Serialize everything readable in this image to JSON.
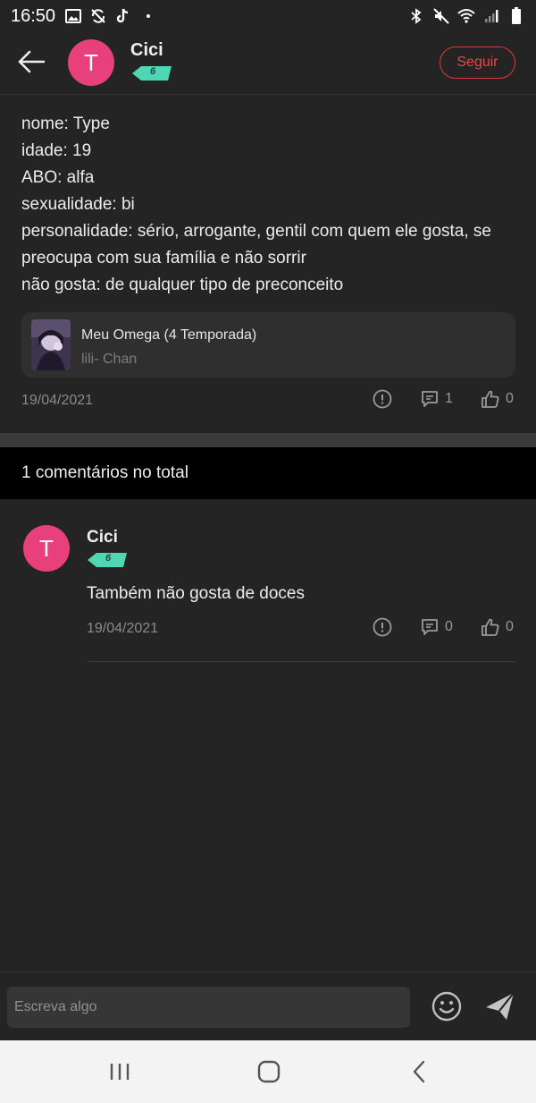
{
  "status_bar": {
    "time": "16:50"
  },
  "header": {
    "user_name": "Cici",
    "avatar_initial": "T",
    "level": "6",
    "follow_label": "Seguir"
  },
  "post": {
    "lines": [
      "nome: Type",
      "idade: 19",
      "ABO: alfa",
      "sexualidade: bi",
      "personalidade: sério, arrogante, gentil com quem ele gosta, se preocupa com sua família e não sorrir",
      "não gosta: de qualquer tipo de preconceito"
    ],
    "linked_story": {
      "title": "Meu Omega (4 Temporada)",
      "author": "lili- Chan"
    },
    "date": "19/04/2021",
    "comment_count": "1",
    "like_count": "0"
  },
  "comments_section": {
    "header": "1 comentários no total",
    "comments": [
      {
        "user_name": "Cici",
        "avatar_initial": "T",
        "level": "6",
        "text": "Também não gosta de doces",
        "date": "19/04/2021",
        "reply_count": "0",
        "like_count": "0"
      }
    ]
  },
  "composer": {
    "placeholder": "Escreva algo"
  },
  "colors": {
    "accent": "#e8407a",
    "follow": "#e0393e",
    "badge": "#4fd6b4",
    "background": "#242424"
  }
}
